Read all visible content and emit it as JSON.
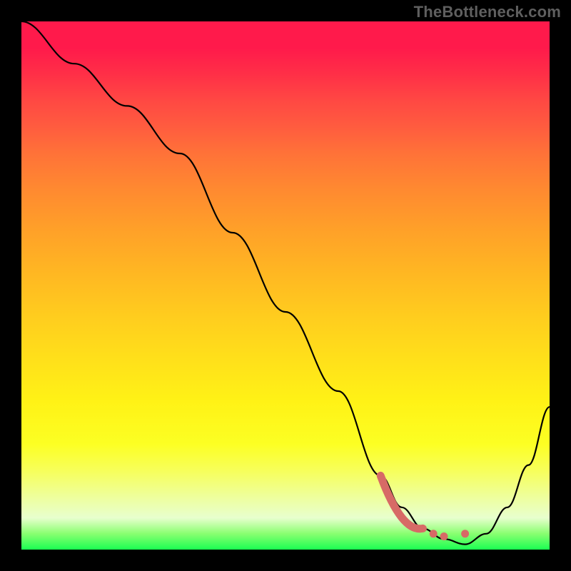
{
  "watermark": "TheBottleneck.com",
  "colors": {
    "accent": "#d76a66",
    "curve": "#000000",
    "frame": "#000000"
  },
  "chart_data": {
    "type": "line",
    "title": "",
    "xlabel": "",
    "ylabel": "",
    "xlim": [
      0,
      100
    ],
    "ylim": [
      0,
      100
    ],
    "grid": false,
    "legend": false,
    "series": [
      {
        "name": "bottleneck-curve",
        "x": [
          0,
          10,
          20,
          30,
          40,
          50,
          60,
          68,
          72,
          76,
          80,
          84,
          88,
          92,
          96,
          100
        ],
        "values": [
          100,
          92,
          84,
          75,
          60,
          45,
          30,
          14,
          8,
          4,
          2,
          1,
          3,
          8,
          16,
          27
        ]
      }
    ],
    "markers": [
      {
        "name": "sweet-spot-range",
        "type": "segment",
        "x_from": 68,
        "x_to": 76,
        "y_from": 14,
        "y_to": 4
      },
      {
        "name": "point-a",
        "type": "point",
        "x": 78,
        "y": 3
      },
      {
        "name": "point-b",
        "type": "point",
        "x": 80,
        "y": 2.5
      },
      {
        "name": "point-c",
        "type": "point",
        "x": 84,
        "y": 3
      }
    ],
    "background": "vertical-gradient",
    "gradient_stops": [
      {
        "pos": 0,
        "color": "#ff1a4b"
      },
      {
        "pos": 50,
        "color": "#ffc81f"
      },
      {
        "pos": 80,
        "color": "#fdff22"
      },
      {
        "pos": 100,
        "color": "#1bff52"
      }
    ]
  }
}
